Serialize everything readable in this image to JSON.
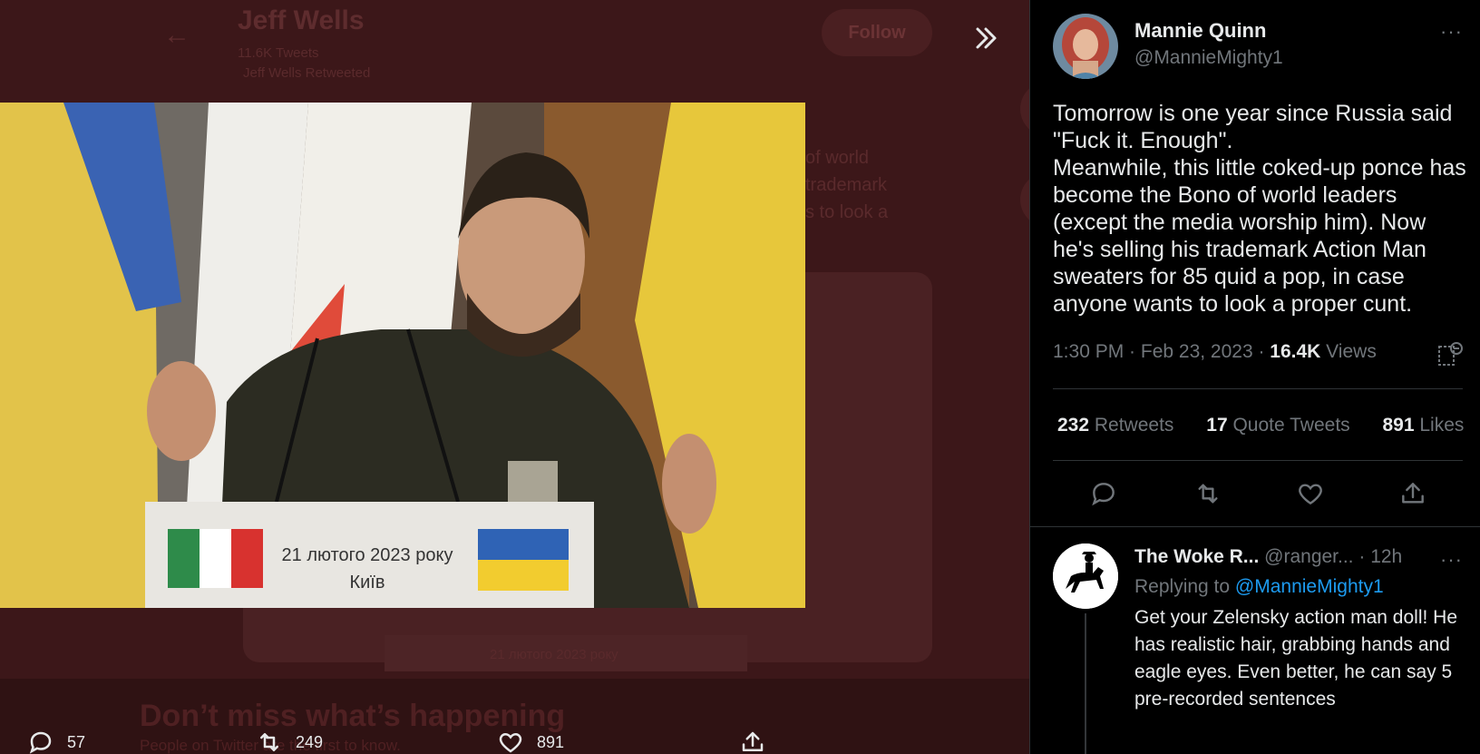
{
  "background": {
    "back_arrow": "←",
    "profile_name": "Jeff Wells",
    "tweet_count": "11.6K Tweets",
    "retweeted_label": "Jeff Wells Retweeted",
    "follow_label": "Follow",
    "snippet_lines": [
      "of world",
      "trademark",
      "s to look a"
    ],
    "card_caption": "21 лютого 2023 року",
    "signup_title": "Don’t miss what’s happening",
    "signup_sub": "People on Twitter are the first to know."
  },
  "media": {
    "caption_line1": "21 лютого 2023 року",
    "caption_line2": "Київ"
  },
  "media_actions": {
    "replies": "57",
    "retweets": "249",
    "likes": "891"
  },
  "tweet": {
    "author_name": "Mannie Quinn",
    "author_handle": "@ManniеMighty1",
    "text": "Tomorrow is one year since Russia said \"Fuck it. Enough\".\nMeanwhile, this little coked-up ponce has become the Bono of world leaders (except the media worship him). Now he's selling his trademark Action Man sweaters for 85 quid a pop, in case anyone wants to look a proper cunt.",
    "time": "1:30 PM · Feb 23, 2023 · ",
    "views_count": "16.4K",
    "views_label": " Views",
    "retweets_count": "232",
    "retweets_label": " Retweets",
    "quotes_count": "17",
    "quotes_label": " Quote Tweets",
    "likes_count": "891",
    "likes_label": " Likes",
    "more": "···"
  },
  "reply": {
    "author_name": "The Woke R...",
    "author_handle": " @ranger...",
    "separator": " · ",
    "time": "12h",
    "replying_prefix": "Replying to ",
    "replying_target": "@MannieMighty1",
    "text": "Get your Zelensky action man doll! He has realistic hair, grabbing hands and eagle eyes. Even better, he can say 5 pre-recorded sentences",
    "more": "···"
  },
  "colors": {
    "accent": "#1d9bf0",
    "backdrop": "#3c1719",
    "muted": "#71767b"
  }
}
